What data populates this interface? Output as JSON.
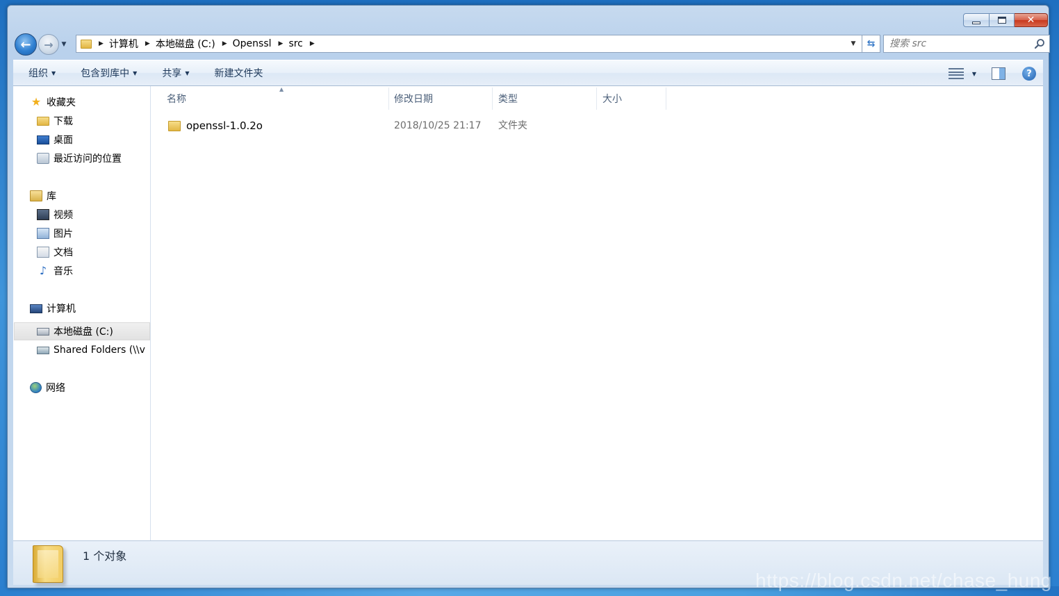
{
  "address_bar": {
    "crumbs": [
      "计算机",
      "本地磁盘 (C:)",
      "Openssl",
      "src"
    ]
  },
  "search": {
    "placeholder": "搜索 src"
  },
  "toolbar": {
    "organize": "组织",
    "include_in_library": "包含到库中",
    "share": "共享",
    "new_folder": "新建文件夹"
  },
  "nav_pane": {
    "favorites": {
      "label": "收藏夹",
      "items": [
        "下载",
        "桌面",
        "最近访问的位置"
      ]
    },
    "libraries": {
      "label": "库",
      "items": [
        "视频",
        "图片",
        "文档",
        "音乐"
      ]
    },
    "computer": {
      "label": "计算机",
      "items": [
        "本地磁盘 (C:)",
        "Shared Folders (\\\\v"
      ]
    },
    "network": {
      "label": "网络"
    }
  },
  "columns": {
    "name": "名称",
    "modified": "修改日期",
    "type": "类型",
    "size": "大小"
  },
  "files": [
    {
      "name": "openssl-1.0.2o",
      "modified": "2018/10/25 21:17",
      "type": "文件夹",
      "size": ""
    }
  ],
  "details": {
    "count": "1 个对象"
  },
  "watermark": "https://blog.csdn.net/chase_hung",
  "colors": {
    "accent": "#1e395b",
    "frame": "#c7daef",
    "selection": "#e2e2e2"
  }
}
